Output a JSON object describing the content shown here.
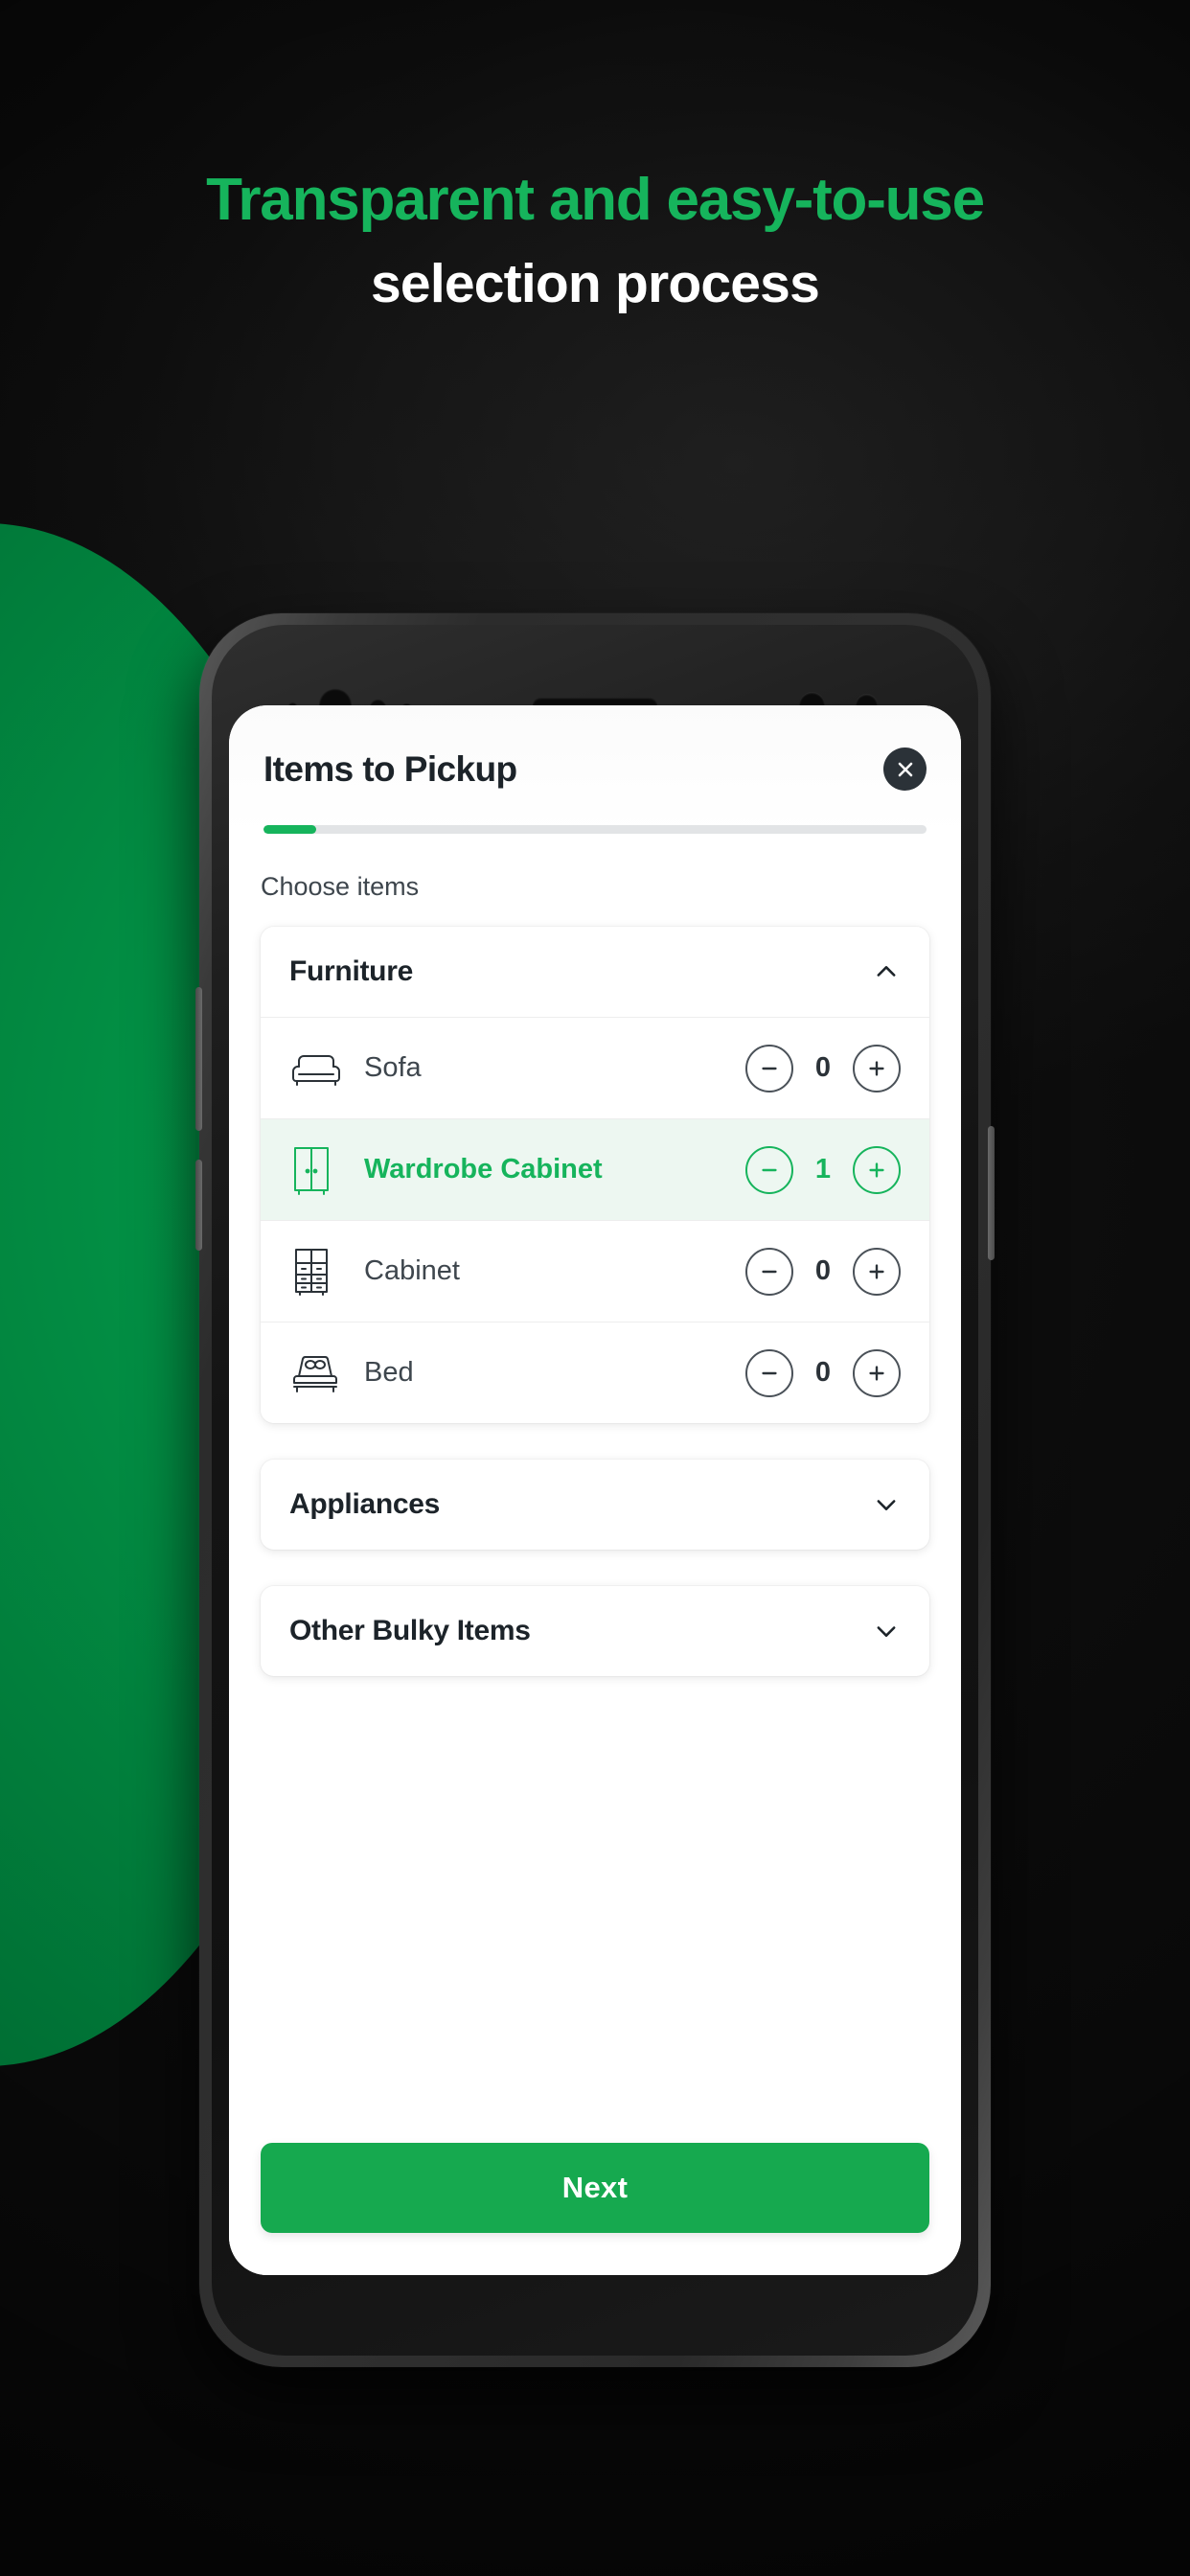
{
  "promo": {
    "headline_line1": "Transparent and easy-to-use",
    "headline_line2": "selection process",
    "accent_green": "#16B45C",
    "blob_green": "#00A94F",
    "background": "#111111"
  },
  "app": {
    "title": "Items to Pickup",
    "close_label": "×",
    "progress_percent": 8,
    "section_label": "Choose items",
    "next_label": "Next",
    "selected_color": "#16B45C",
    "button_color": "#16A94F",
    "categories": [
      {
        "name": "Furniture",
        "expanded": true,
        "chevron": "chevron-up-icon",
        "items": [
          {
            "icon": "sofa-icon",
            "label": "Sofa",
            "qty": "0",
            "selected": false
          },
          {
            "icon": "wardrobe-icon",
            "label": "Wardrobe Cabinet",
            "qty": "1",
            "selected": true
          },
          {
            "icon": "cabinet-icon",
            "label": "Cabinet",
            "qty": "0",
            "selected": false
          },
          {
            "icon": "bed-icon",
            "label": "Bed",
            "qty": "0",
            "selected": false
          }
        ]
      },
      {
        "name": "Appliances",
        "expanded": false,
        "chevron": "chevron-down-icon",
        "items": []
      },
      {
        "name": "Other Bulky Items",
        "expanded": false,
        "chevron": "chevron-down-icon",
        "items": []
      }
    ]
  }
}
